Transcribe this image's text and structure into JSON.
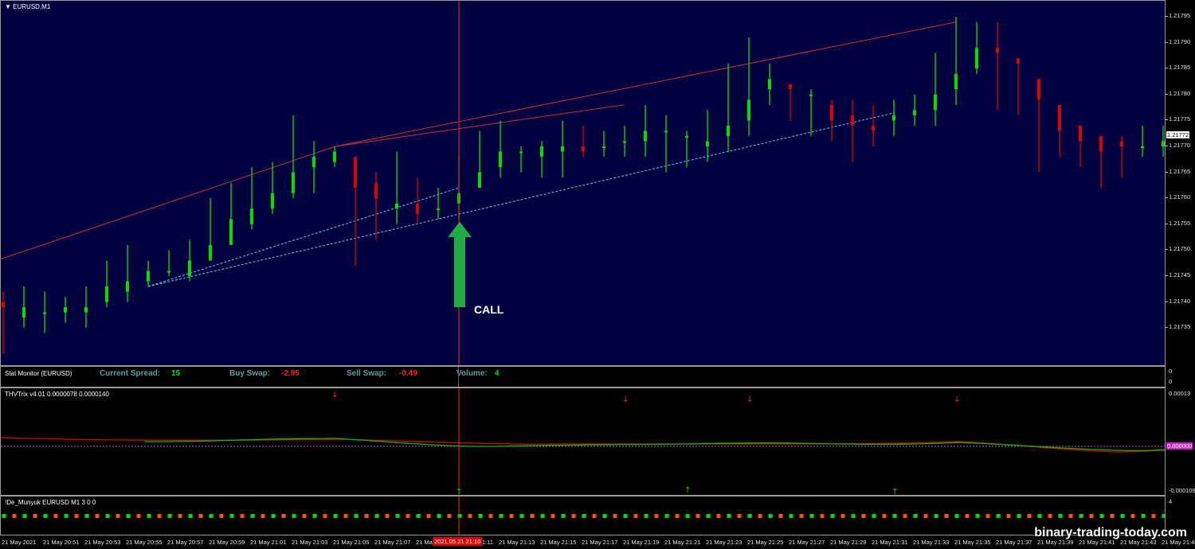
{
  "main": {
    "title": "EURUSD,M1",
    "call_label": "CALL",
    "price_labels": [
      "1.21795",
      "1.21790",
      "1.21785",
      "1.21780",
      "1.21775",
      "1.21770",
      "1.21765",
      "1.21760",
      "1.21755",
      "1.21750",
      "1.21745",
      "1.21740",
      "1.21735"
    ],
    "current_price": "1.21772",
    "colors": {
      "background": "#000040",
      "bull": "#00e000",
      "bear": "#dd0000",
      "channel": "#cc3333",
      "support": "#66ccee",
      "arrow": "#22aa44",
      "crosshair": "#ff2222"
    },
    "price_range": [
      1.2173,
      1.218
    ],
    "candles": [
      {
        "o": 1.2174,
        "h": 1.21742,
        "l": 1.2173,
        "c": 1.21739
      },
      {
        "o": 1.21737,
        "h": 1.21743,
        "l": 1.21735,
        "c": 1.21739
      },
      {
        "o": 1.21738,
        "h": 1.21742,
        "l": 1.21734,
        "c": 1.21738
      },
      {
        "o": 1.21738,
        "h": 1.21741,
        "l": 1.21736,
        "c": 1.21739
      },
      {
        "o": 1.21738,
        "h": 1.21743,
        "l": 1.21735,
        "c": 1.21739
      },
      {
        "o": 1.2174,
        "h": 1.21748,
        "l": 1.21739,
        "c": 1.21743
      },
      {
        "o": 1.21742,
        "h": 1.21751,
        "l": 1.2174,
        "c": 1.21744
      },
      {
        "o": 1.21744,
        "h": 1.21748,
        "l": 1.21743,
        "c": 1.21746
      },
      {
        "o": 1.21746,
        "h": 1.2175,
        "l": 1.21745,
        "c": 1.21746
      },
      {
        "o": 1.21745,
        "h": 1.21752,
        "l": 1.21744,
        "c": 1.21748
      },
      {
        "o": 1.21748,
        "h": 1.2176,
        "l": 1.21748,
        "c": 1.21751
      },
      {
        "o": 1.21751,
        "h": 1.21763,
        "l": 1.21751,
        "c": 1.21756
      },
      {
        "o": 1.21755,
        "h": 1.21766,
        "l": 1.21754,
        "c": 1.21758
      },
      {
        "o": 1.21758,
        "h": 1.21767,
        "l": 1.21757,
        "c": 1.21761
      },
      {
        "o": 1.21761,
        "h": 1.21776,
        "l": 1.2176,
        "c": 1.21765
      },
      {
        "o": 1.21766,
        "h": 1.21771,
        "l": 1.21761,
        "c": 1.21768
      },
      {
        "o": 1.21767,
        "h": 1.2177,
        "l": 1.21766,
        "c": 1.21769
      },
      {
        "o": 1.21768,
        "h": 1.21768,
        "l": 1.21747,
        "c": 1.21762
      },
      {
        "o": 1.21763,
        "h": 1.21765,
        "l": 1.21752,
        "c": 1.2176
      },
      {
        "o": 1.21758,
        "h": 1.21769,
        "l": 1.21755,
        "c": 1.21759
      },
      {
        "o": 1.21759,
        "h": 1.21764,
        "l": 1.21755,
        "c": 1.21757
      },
      {
        "o": 1.21758,
        "h": 1.21762,
        "l": 1.21756,
        "c": 1.21758
      },
      {
        "o": 1.21759,
        "h": 1.21768,
        "l": 1.21756,
        "c": 1.21761
      },
      {
        "o": 1.21762,
        "h": 1.21773,
        "l": 1.21762,
        "c": 1.21765
      },
      {
        "o": 1.21766,
        "h": 1.21775,
        "l": 1.21764,
        "c": 1.21769
      },
      {
        "o": 1.21769,
        "h": 1.2177,
        "l": 1.21765,
        "c": 1.21769
      },
      {
        "o": 1.21768,
        "h": 1.21771,
        "l": 1.21764,
        "c": 1.2177
      },
      {
        "o": 1.21769,
        "h": 1.21775,
        "l": 1.21764,
        "c": 1.2177
      },
      {
        "o": 1.2177,
        "h": 1.21774,
        "l": 1.21768,
        "c": 1.21769
      },
      {
        "o": 1.2177,
        "h": 1.21773,
        "l": 1.21768,
        "c": 1.2177
      },
      {
        "o": 1.21771,
        "h": 1.21774,
        "l": 1.21768,
        "c": 1.21771
      },
      {
        "o": 1.21771,
        "h": 1.21778,
        "l": 1.21768,
        "c": 1.21773
      },
      {
        "o": 1.21773,
        "h": 1.21776,
        "l": 1.21765,
        "c": 1.21773
      },
      {
        "o": 1.21772,
        "h": 1.21773,
        "l": 1.21766,
        "c": 1.21772
      },
      {
        "o": 1.2177,
        "h": 1.21777,
        "l": 1.21767,
        "c": 1.21771
      },
      {
        "o": 1.21772,
        "h": 1.21786,
        "l": 1.21769,
        "c": 1.21774
      },
      {
        "o": 1.21775,
        "h": 1.21791,
        "l": 1.21772,
        "c": 1.21779
      },
      {
        "o": 1.21781,
        "h": 1.21786,
        "l": 1.21778,
        "c": 1.21783
      },
      {
        "o": 1.21782,
        "h": 1.21782,
        "l": 1.21775,
        "c": 1.21781
      },
      {
        "o": 1.2178,
        "h": 1.21781,
        "l": 1.21772,
        "c": 1.2178
      },
      {
        "o": 1.21778,
        "h": 1.21779,
        "l": 1.21771,
        "c": 1.21775
      },
      {
        "o": 1.21776,
        "h": 1.21779,
        "l": 1.21767,
        "c": 1.21774
      },
      {
        "o": 1.21774,
        "h": 1.21778,
        "l": 1.2177,
        "c": 1.21773
      },
      {
        "o": 1.21775,
        "h": 1.21779,
        "l": 1.21772,
        "c": 1.21776
      },
      {
        "o": 1.21776,
        "h": 1.2178,
        "l": 1.21774,
        "c": 1.21777
      },
      {
        "o": 1.21777,
        "h": 1.21788,
        "l": 1.21774,
        "c": 1.2178
      },
      {
        "o": 1.21781,
        "h": 1.21795,
        "l": 1.21778,
        "c": 1.21784
      },
      {
        "o": 1.21785,
        "h": 1.21794,
        "l": 1.21784,
        "c": 1.21789
      },
      {
        "o": 1.21789,
        "h": 1.21794,
        "l": 1.21777,
        "c": 1.21788
      },
      {
        "o": 1.21787,
        "h": 1.21787,
        "l": 1.21776,
        "c": 1.21786
      },
      {
        "o": 1.21783,
        "h": 1.21783,
        "l": 1.21765,
        "c": 1.21779
      },
      {
        "o": 1.21778,
        "h": 1.21777,
        "l": 1.21768,
        "c": 1.21773
      },
      {
        "o": 1.21774,
        "h": 1.21774,
        "l": 1.21766,
        "c": 1.21771
      },
      {
        "o": 1.21772,
        "h": 1.21772,
        "l": 1.21762,
        "c": 1.21769
      },
      {
        "o": 1.21771,
        "h": 1.21772,
        "l": 1.21764,
        "c": 1.2177
      },
      {
        "o": 1.2177,
        "h": 1.21774,
        "l": 1.21768,
        "c": 1.2177
      },
      {
        "o": 1.2177,
        "h": 1.21774,
        "l": 1.21768,
        "c": 1.21771
      },
      {
        "o": 1.21772,
        "h": 1.21781,
        "l": 1.21771,
        "c": 1.2178
      }
    ]
  },
  "stat_monitor": {
    "title": "Stat Monitor (EURUSD)",
    "spread_label": "Current Spread:",
    "spread_value": "15",
    "buy_swap_label": "Buy Swap:",
    "buy_swap_value": "-2.95",
    "sell_swap_label": "Sell Swap:",
    "sell_swap_value": "-0.49",
    "volume_label": "Volume:",
    "volume_value": "4",
    "axis_top": "0",
    "axis_bottom": "0"
  },
  "trix": {
    "title": "THVTrix v4.01 0.0000078 0.0000140",
    "axis_top": "0.00013",
    "axis_zero": "0.000000",
    "axis_bottom": "-0.000109"
  },
  "munyuk": {
    "title": "!De_Munyuk EURUSD M1 3 0 0",
    "axis_top": "4"
  },
  "time_axis": {
    "labels": [
      "21 May 2021",
      "21 May 20:51",
      "21 May 20:53",
      "21 May 20:55",
      "21 May 20:57",
      "21 May 20:59",
      "21 May 21:01",
      "21 May 21:03",
      "21 May 21:05",
      "21 May 21:07",
      "21 May 21:09",
      "21 May 21:11",
      "21 May 21:13",
      "21 May 21:15",
      "21 May 21:17",
      "21 May 21:19",
      "21 May 21:21",
      "21 May 21:23",
      "21 May 21:25",
      "21 May 21:27",
      "21 May 21:29",
      "21 May 21:31",
      "21 May 21:33",
      "21 May 21:35",
      "21 May 21:37",
      "21 May 21:39",
      "21 May 21:41",
      "21 May 21:43",
      "21 May 21:45"
    ],
    "crosshair_label": "2021.05.21 21:10"
  },
  "watermark": "binary-trading-today.com"
}
